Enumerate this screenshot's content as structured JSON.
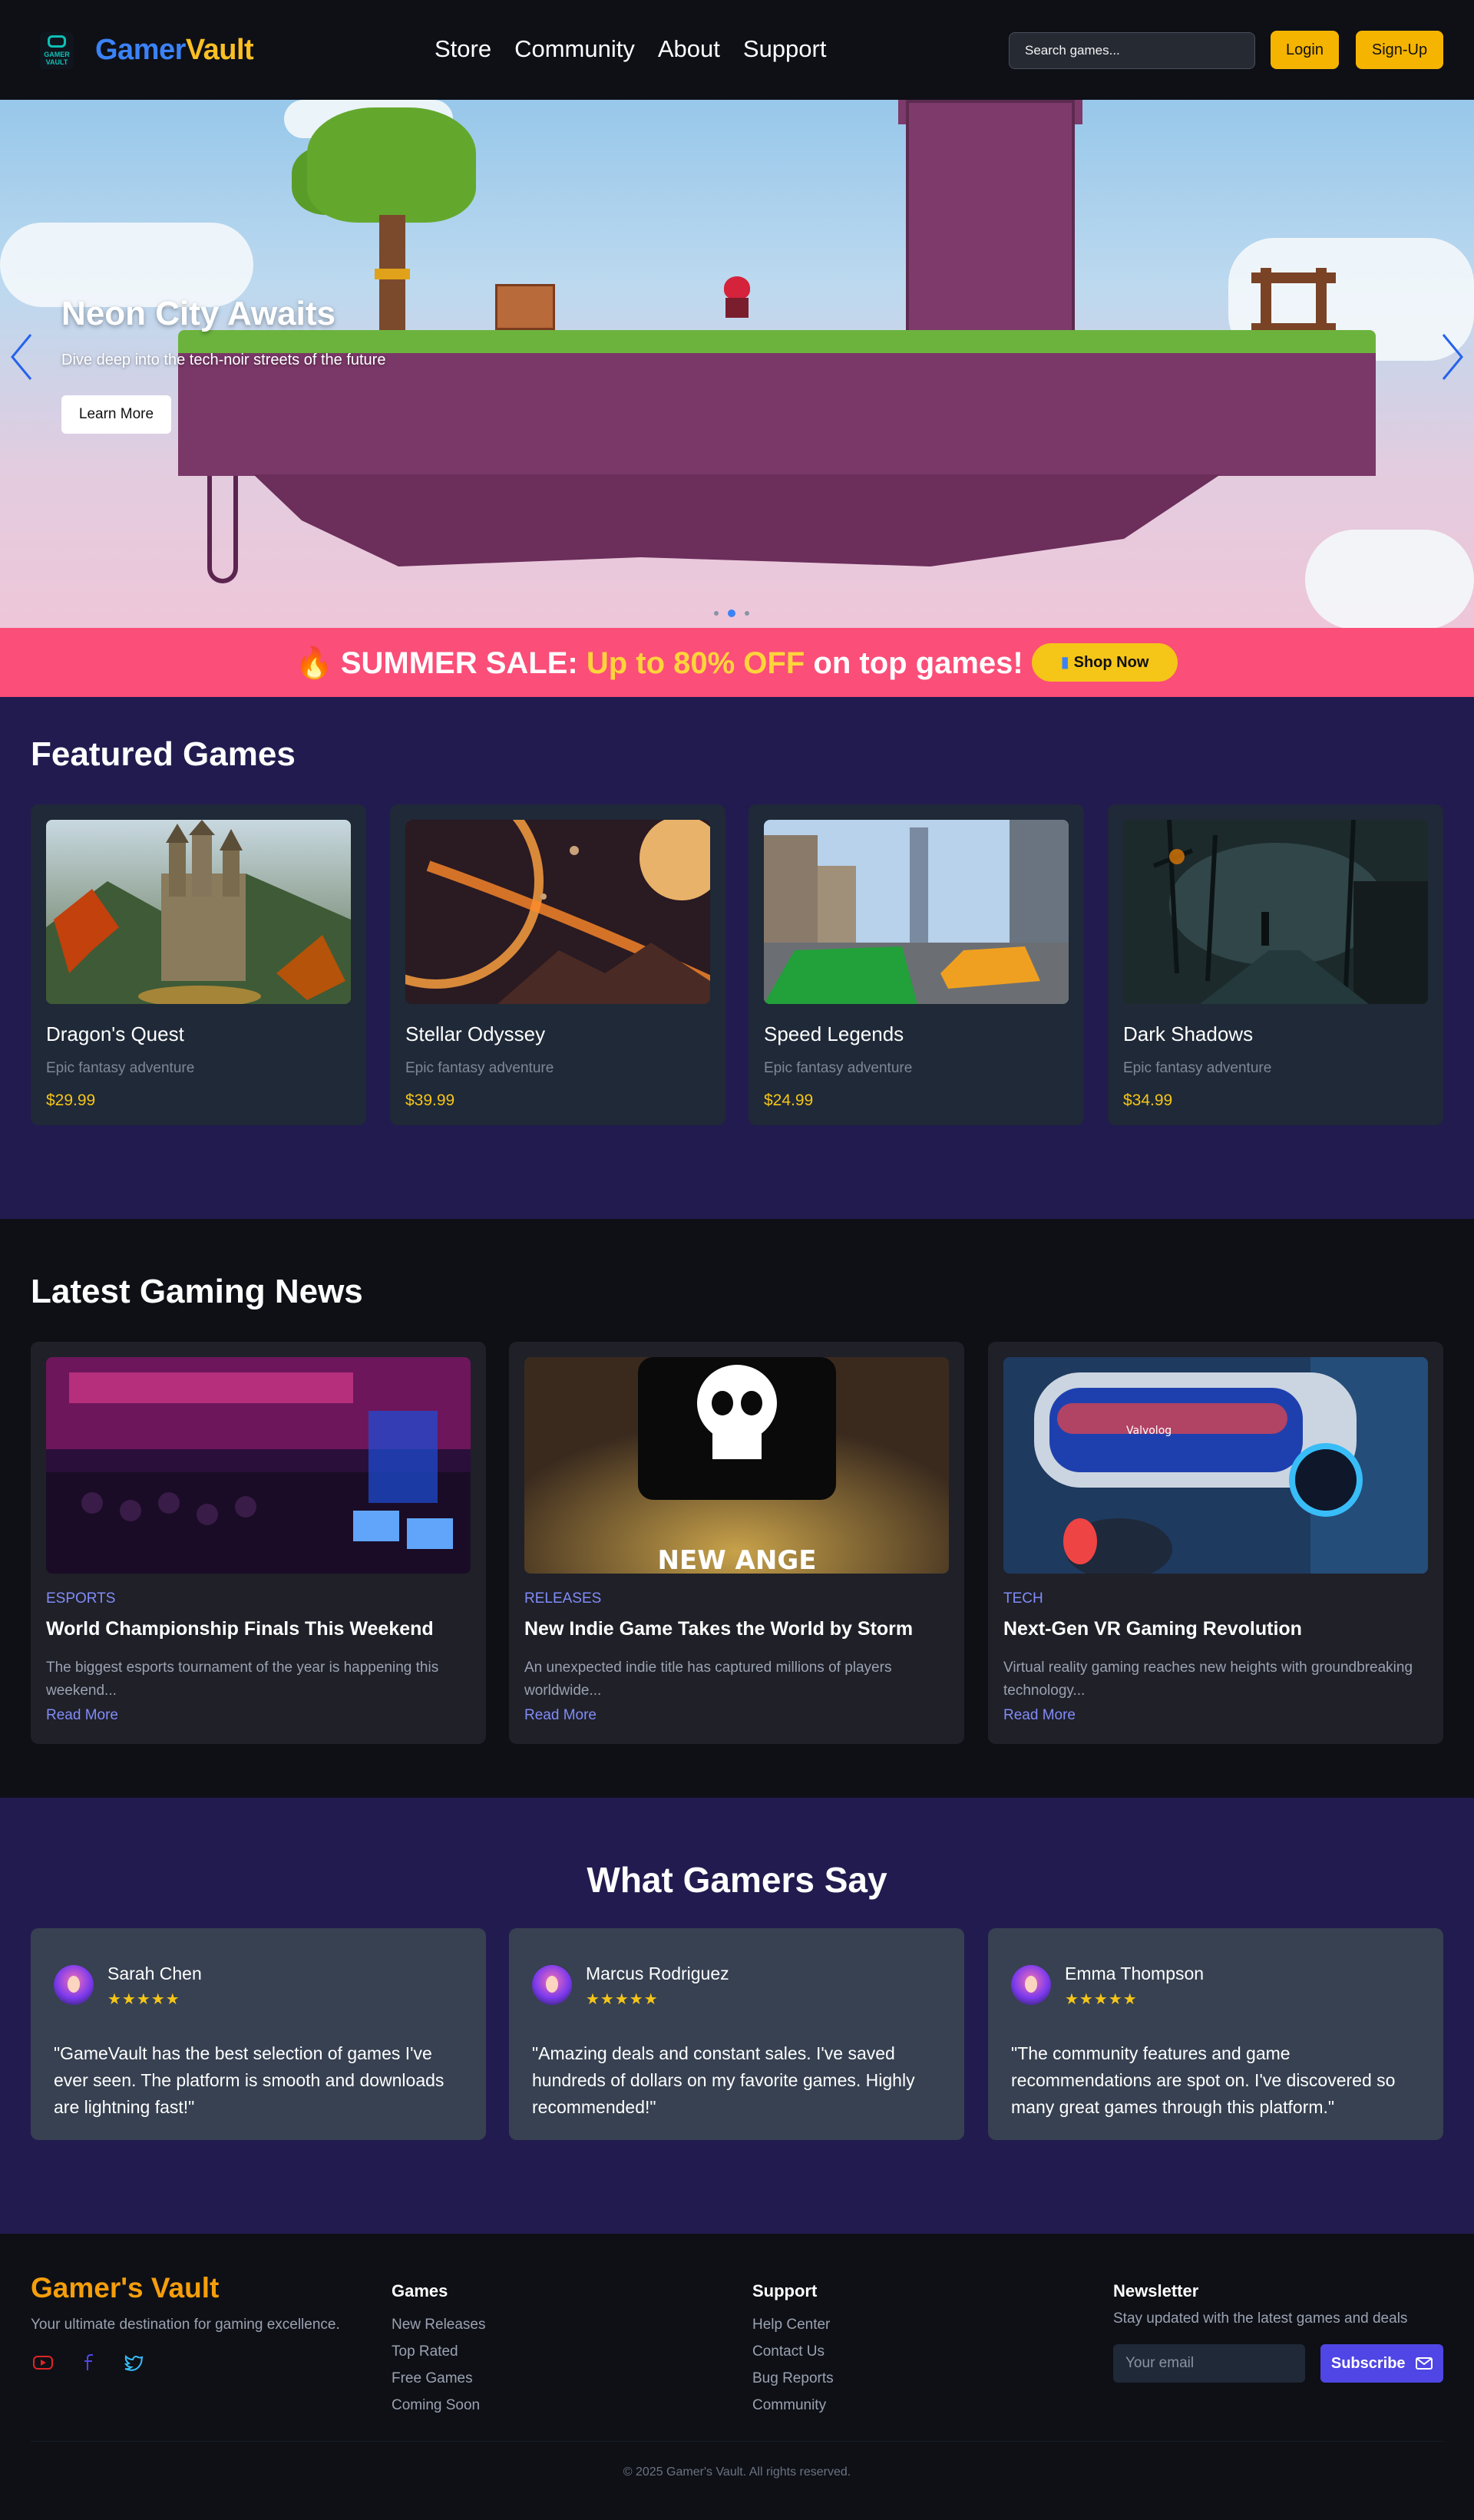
{
  "nav": {
    "logo_line1": "GAMER",
    "logo_line2": "VAULT",
    "brand_part1": "Gamer",
    "brand_part2": "Vault",
    "links": [
      "Store",
      "Community",
      "About",
      "Support"
    ],
    "search_placeholder": "Search games...",
    "login_label": "Login",
    "signup_label": "Sign-Up"
  },
  "hero": {
    "title": "Neon City Awaits",
    "subtitle": "Dive deep into the tech-noir streets of the future",
    "button_label": "Learn More",
    "active_slide": 2,
    "slide_count": 3
  },
  "sale": {
    "icon": "flame-icon",
    "label": "SUMMER SALE:",
    "highlight": "Up to 80% OFF",
    "rest": "on top games!",
    "button_icon": "shopping-bag-icon",
    "button_label": "Shop Now"
  },
  "featured": {
    "title": "Featured Games",
    "games": [
      {
        "name": "Dragon's Quest",
        "desc": "Epic fantasy adventure",
        "price": "$29.99"
      },
      {
        "name": "Stellar Odyssey",
        "desc": "Epic fantasy adventure",
        "price": "$39.99"
      },
      {
        "name": "Speed Legends",
        "desc": "Epic fantasy adventure",
        "price": "$24.99"
      },
      {
        "name": "Dark Shadows",
        "desc": "Epic fantasy adventure",
        "price": "$34.99"
      }
    ]
  },
  "news": {
    "title": "Latest Gaming News",
    "articles": [
      {
        "category": "ESPORTS",
        "title": "World Championship Finals This Weekend",
        "excerpt": "The biggest esports tournament of the year is happening this weekend...",
        "link": "Read More"
      },
      {
        "category": "RELEASES",
        "title": "New Indie Game Takes the World by Storm",
        "excerpt": "An unexpected indie title has captured millions of players worldwide...",
        "link": "Read More",
        "image_text": "NEW ANGE"
      },
      {
        "category": "TECH",
        "title": "Next-Gen VR Gaming Revolution",
        "excerpt": "Virtual reality gaming reaches new heights with groundbreaking technology...",
        "link": "Read More",
        "image_text": "Valvolog"
      }
    ]
  },
  "testimonials": {
    "title": "What Gamers Say",
    "items": [
      {
        "name": "Sarah Chen",
        "stars": "★★★★★",
        "rating": 5,
        "quote": "\"GameVault has the best selection of games I've ever seen. The platform is smooth and downloads are lightning fast!\""
      },
      {
        "name": "Marcus Rodriguez",
        "stars": "★★★★★",
        "rating": 5,
        "quote": "\"Amazing deals and constant sales. I've saved hundreds of dollars on my favorite games. Highly recommended!\""
      },
      {
        "name": "Emma Thompson",
        "stars": "★★★★★",
        "rating": 5,
        "quote": "\"The community features and game recommendations are spot on. I've discovered so many great games through this platform.\""
      }
    ]
  },
  "footer": {
    "brand": "Gamer's Vault",
    "tagline": "Your ultimate destination for gaming excellence.",
    "social": [
      "youtube-icon",
      "facebook-icon",
      "twitter-icon"
    ],
    "games_title": "Games",
    "games_links": [
      "New Releases",
      "Top Rated",
      "Free Games",
      "Coming Soon"
    ],
    "support_title": "Support",
    "support_links": [
      "Help Center",
      "Contact Us",
      "Bug Reports",
      "Community"
    ],
    "newsletter_title": "Newsletter",
    "newsletter_desc": "Stay updated with the latest games and deals",
    "email_placeholder": "Your email",
    "subscribe_label": "Subscribe",
    "copyright": "© 2025 Gamer's Vault. All rights reserved."
  },
  "colors": {
    "accent_blue": "#3b82f6",
    "accent_gold": "#f5b400",
    "sale_pink": "#fb4e78",
    "section_purple": "#221b4f",
    "link_indigo": "#818cf8"
  }
}
